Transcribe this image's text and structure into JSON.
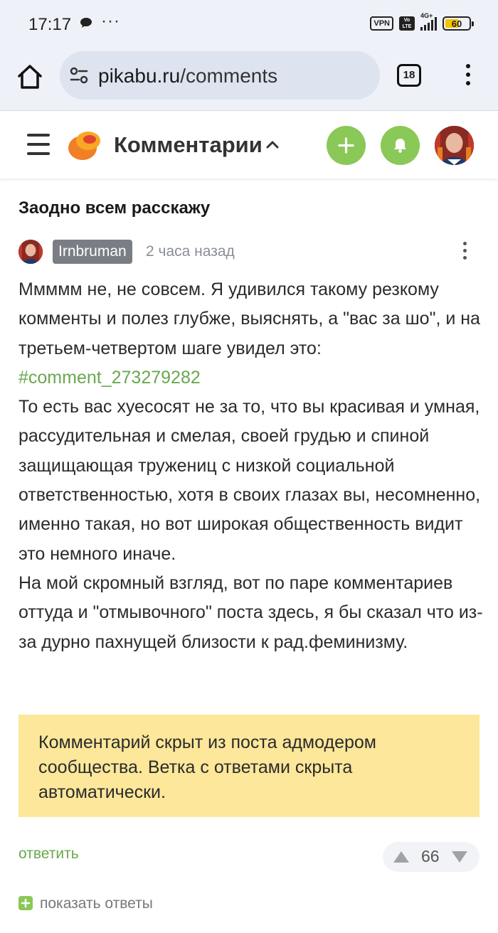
{
  "status_bar": {
    "time": "17:17",
    "dots": "···",
    "vpn": "VPN",
    "volte": "Vo LTE",
    "network": "4G+",
    "battery": "60"
  },
  "browser": {
    "url_domain": "pikabu.ru",
    "url_path": "/comments",
    "tab_count": "18"
  },
  "header": {
    "title": "Комментарии",
    "accent_color": "#8ac858"
  },
  "post": {
    "title": "Заодно всем расскажу"
  },
  "comment": {
    "author": "Irnbruman",
    "time": "2 часа назад",
    "text_part1": "Ммммм не, не совсем. Я удивился такому резкому комменты и полез глубже, выяснять, а \"вас за шо\", и на третьем-четвертом шаге увидел это: ",
    "tag_link": "#comment_273279282",
    "text_part2": "То есть вас хуесосят не за то, что вы красивая и умная, рассудительная и смелая, своей грудью и спиной защищающая тружениц с низкой социальной ответственностью, хотя в своих глазах вы, несомненно, именно такая, но вот широкая общественность видит это немного иначе.",
    "text_part3": "На мой скромный взгляд, вот по паре комментариев оттуда и \"отмывочного\" поста здесь, я бы сказал что из-за дурно пахнущей близости к рад.феминизму.",
    "hidden_notice": "Комментарий скрыт из поста адмодером сообщества. Ветка с ответами скрыта автоматически.",
    "reply_label": "ответить",
    "rating": "66",
    "show_replies_label": "показать ответы"
  }
}
